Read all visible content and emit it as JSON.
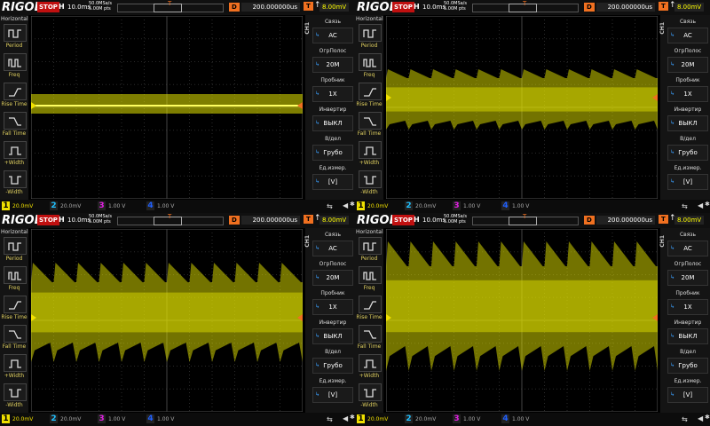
{
  "scope": {
    "brand": "RIGOL",
    "run_state": "STOP",
    "h_label": "H",
    "h_scale": "10.0ms",
    "sample_rate": "50.0MSa/s",
    "mem_depth": "5.00M pts",
    "delay_label": "D",
    "delay_value": "200.000000us",
    "trig_label": "T",
    "trig_edge": "↑",
    "trig_value": "8.00mV",
    "trigger_marker": "T",
    "left_menu": {
      "title": "Horizontal",
      "items": [
        "Period",
        "Freq",
        "Rise Time",
        "Fall Time",
        "+Width",
        "-Width"
      ]
    },
    "right_menu": {
      "channel_tag": "CH1",
      "items": [
        {
          "label": "Связь",
          "value": "AC"
        },
        {
          "label": "ОгрПолос",
          "value": "20M"
        },
        {
          "label": "Пробник",
          "value": "1X"
        },
        {
          "label": "Инвертир",
          "value": "ВЫКЛ"
        },
        {
          "label": "В/дел",
          "value": "Грубо"
        },
        {
          "label": "Ед.измер.",
          "value": "[V]"
        }
      ]
    },
    "channels": [
      {
        "num": "1",
        "value": "20.0mV",
        "color": "#f0e000"
      },
      {
        "num": "2",
        "value": "20.0mV",
        "color": "#20c0ff"
      },
      {
        "num": "3",
        "value": "1.00 V",
        "color": "#e020e0"
      },
      {
        "num": "4",
        "value": "1.00 V",
        "color": "#2060ff"
      }
    ],
    "trace_color": "#e6e600"
  },
  "panels": [
    {
      "id": "p1",
      "signal": "low ripple, flat band"
    },
    {
      "id": "p2",
      "signal": "sawtooth ripple medium"
    },
    {
      "id": "p3",
      "signal": "sawtooth ripple larger"
    },
    {
      "id": "p4",
      "signal": "sawtooth ripple largest"
    }
  ]
}
